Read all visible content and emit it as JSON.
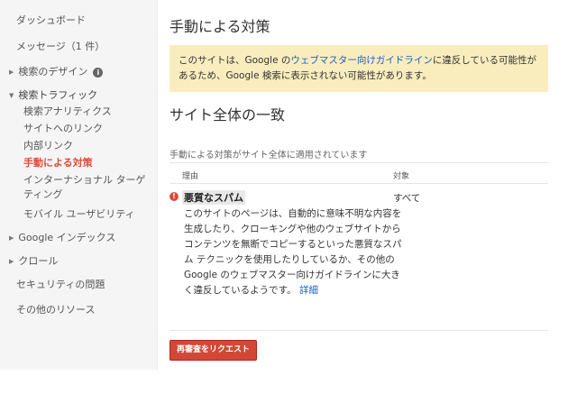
{
  "sidebar": {
    "dashboard": "ダッシュボード",
    "messages": "メッセージ（1 件）",
    "search_appearance": "検索のデザイン",
    "search_traffic": "検索トラフィック",
    "traffic_items": [
      {
        "label": "検索アナリティクス"
      },
      {
        "label": "サイトへのリンク"
      },
      {
        "label": "内部リンク"
      },
      {
        "label": "手動による対策"
      },
      {
        "label": "インターナショナル ターゲティング"
      },
      {
        "label": "モバイル ユーザビリティ"
      }
    ],
    "google_index": "Google インデックス",
    "crawl": "クロール",
    "security": "セキュリティの問題",
    "other_resources": "その他のリソース"
  },
  "main": {
    "title": "手動による対策",
    "warning": {
      "prefix": "このサイトは、Google の",
      "link": "ウェブマスター向けガイドライン",
      "suffix": "に違反している可能性があるため、Google 検索に表示されない可能性があります。"
    },
    "section_title": "サイト全体の一致",
    "applied_note": "手動による対策がサイト全体に適用されています",
    "col_reason": "理由",
    "col_target": "対象",
    "reason_title": "悪質なスパム",
    "reason_body": "このサイトのページは、自動的に意味不明な内容を生成したり、クローキングや他のウェブサイトからコンテンツを無断でコピーするといった悪質なスパム テクニックを使用したりしているか、その他の Google のウェブマスター向けガイドラインに大きく違反しているようです。",
    "details_link": "詳細",
    "target_value": "すべて",
    "request_button": "再審査をリクエスト"
  },
  "colors": {
    "accent_red": "#dd4b39",
    "warning_bg": "#f9edbe",
    "link_blue": "#1a5dbf"
  }
}
